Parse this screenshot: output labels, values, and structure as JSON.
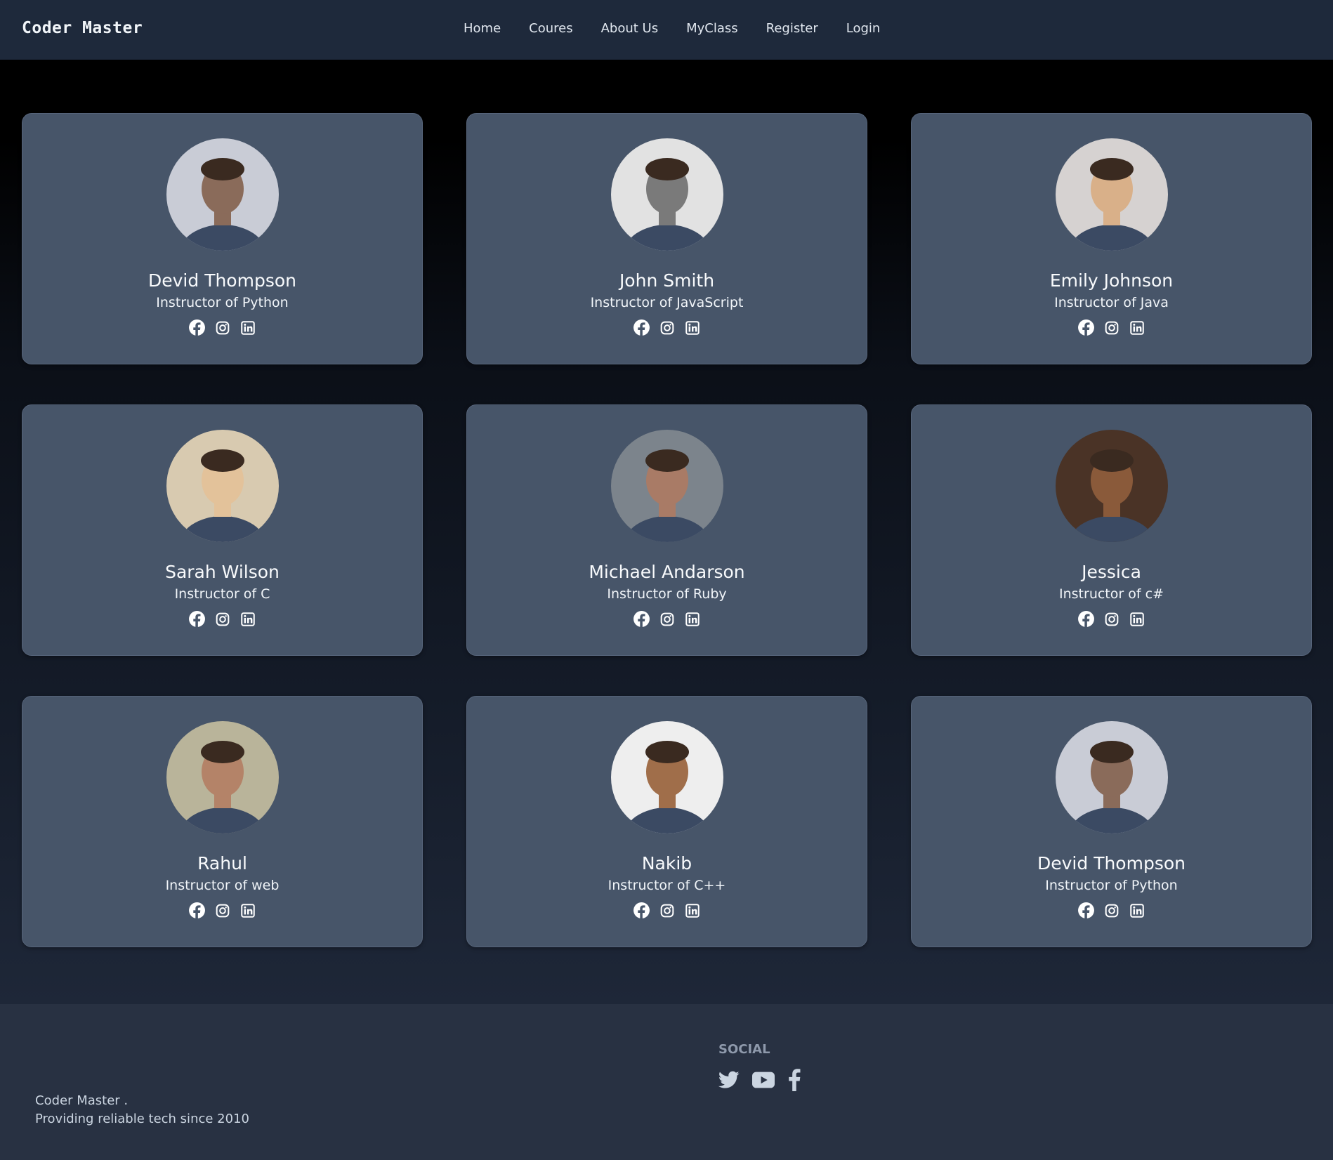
{
  "brand": "Coder Master",
  "nav": {
    "items": [
      "Home",
      "Coures",
      "About Us",
      "MyClass",
      "Register",
      "Login"
    ]
  },
  "instructors": [
    {
      "name": "Devid Thompson",
      "role": "Instructor of Python",
      "photo_tone": "#8a6b5a",
      "bg_tone": "#c9ccd6"
    },
    {
      "name": "John Smith",
      "role": "Instructor of JavaScript",
      "photo_tone": "#7a7a7a",
      "bg_tone": "#e2e2e2"
    },
    {
      "name": "Emily Johnson",
      "role": "Instructor of Java",
      "photo_tone": "#d9b089",
      "bg_tone": "#d6d2d1"
    },
    {
      "name": "Sarah Wilson",
      "role": "Instructor of C",
      "photo_tone": "#e3c29a",
      "bg_tone": "#d8cab0"
    },
    {
      "name": "Michael Andarson",
      "role": "Instructor of Ruby",
      "photo_tone": "#a97b66",
      "bg_tone": "#7c848c"
    },
    {
      "name": "Jessica",
      "role": "Instructor of c#",
      "photo_tone": "#8a5a3a",
      "bg_tone": "#4a3326"
    },
    {
      "name": "Rahul",
      "role": "Instructor of web",
      "photo_tone": "#b48368",
      "bg_tone": "#b9b49a"
    },
    {
      "name": "Nakib",
      "role": "Instructor of C++",
      "photo_tone": "#a06e4a",
      "bg_tone": "#eeeeee"
    },
    {
      "name": "Devid Thompson",
      "role": "Instructor of Python",
      "photo_tone": "#8a6b5a",
      "bg_tone": "#c9ccd6"
    }
  ],
  "card_icons": [
    "facebook-icon",
    "instagram-icon",
    "linkedin-icon"
  ],
  "footer": {
    "brand_line": "Coder Master .",
    "tagline": "Providing reliable tech since 2010",
    "social_heading": "SOCIAL",
    "icons": [
      "twitter-icon",
      "youtube-icon",
      "facebook-f-icon"
    ]
  },
  "colors": {
    "navbar": "#1e293b",
    "card": "#475569",
    "footer": "#283142"
  }
}
